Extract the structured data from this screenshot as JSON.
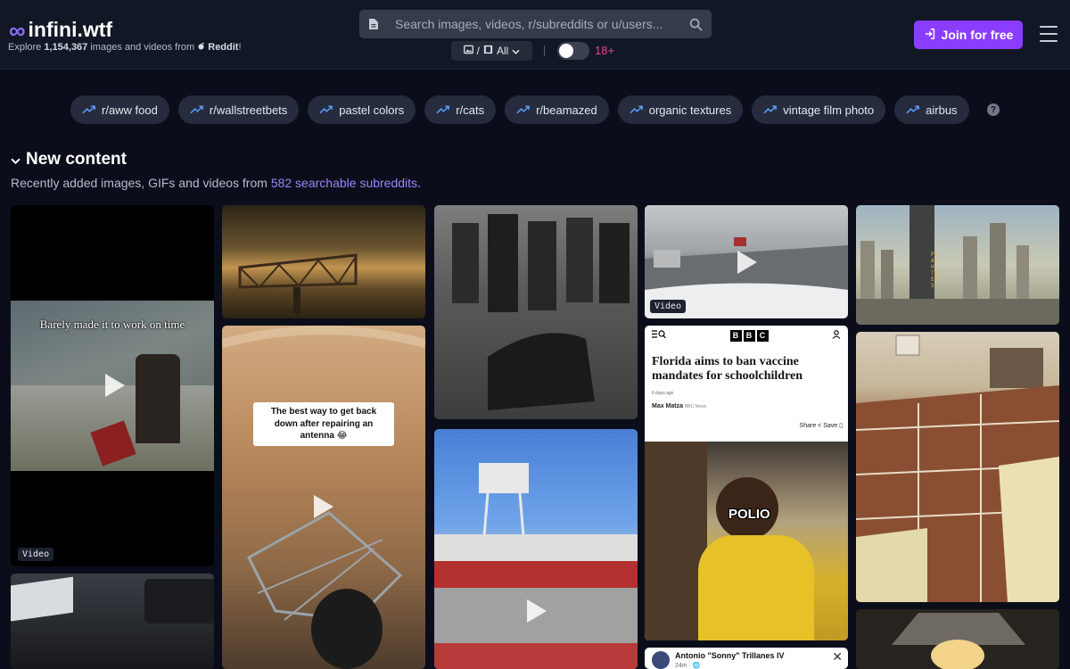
{
  "header": {
    "logo_symbol": "∞",
    "logo_text": "infini.wtf",
    "tagline_prefix": "Explore ",
    "tagline_count": "1,154,367",
    "tagline_mid": " images and videos from ",
    "tagline_source": "Reddit",
    "tagline_suffix": "!",
    "search_placeholder": "Search images, videos, r/subreddits or u/users...",
    "filter_separator": "/",
    "filter_label": "All",
    "divider": "|",
    "nsfw_label": "18+",
    "join_label": "Join for free"
  },
  "trending": [
    "r/aww food",
    "r/wallstreetbets",
    "pastel colors",
    "r/cats",
    "r/beamazed",
    "organic textures",
    "vintage film photo",
    "airbus"
  ],
  "help_label": "?",
  "section": {
    "title": "New content",
    "subtitle_prefix": "Recently added images, GIFs and videos from ",
    "subtitle_link": "582 searchable subreddits",
    "subtitle_suffix": "."
  },
  "media": {
    "video_badge": "Video",
    "caption_work": "Barely made it to work on time",
    "caption_antenna": "The best way to get back down after repairing an antenna 😂",
    "caption_polio": "POLIO",
    "tower_letters": "PEACH TREES"
  },
  "bbc": {
    "logo": [
      "B",
      "B",
      "C"
    ],
    "headline": "Florida aims to ban vaccine mandates for schoolchildren",
    "date": "6 days ago",
    "author": "Max Matza",
    "author_org": "BBC News",
    "share": "Share",
    "save": "Save"
  },
  "fb": {
    "name": "Antonio \"Sonny\" Trillanes IV",
    "time": "24m · 🌐"
  },
  "colors": {
    "background": "#0b0e1a",
    "header": "#121726",
    "accent": "#8b3dff",
    "link": "#9e84ff",
    "nsfw": "#e0468c",
    "pill": "#262c3d"
  }
}
